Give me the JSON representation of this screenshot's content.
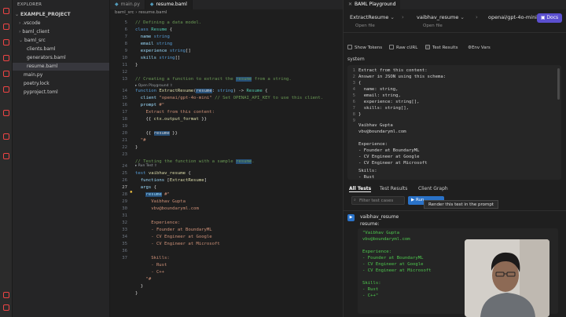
{
  "explorer": {
    "title": "EXPLORER",
    "items": [
      {
        "label": "EXAMPLE_PROJECT",
        "caret": "⌄"
      },
      {
        "label": ".vscode",
        "caret": "›"
      },
      {
        "label": "baml_client",
        "caret": "›"
      },
      {
        "label": "baml_src",
        "caret": "⌄"
      },
      {
        "label": "clients.baml",
        "caret": ""
      },
      {
        "label": "generators.baml",
        "caret": ""
      },
      {
        "label": "resume.baml",
        "caret": ""
      },
      {
        "label": "main.py",
        "caret": ""
      },
      {
        "label": "poetry.lock",
        "caret": ""
      },
      {
        "label": "pyproject.toml",
        "caret": ""
      }
    ]
  },
  "editor": {
    "tabs": [
      "main.py",
      "resume.baml"
    ],
    "breadcrumb": "baml_src  ›  resume.baml",
    "codelens_1": "▸ Open Playground ⇧",
    "codelens_2": "▸ Run Test ⇧",
    "line_numbers": [
      "5",
      "6",
      "7",
      "8",
      "9",
      "10",
      "11",
      "12",
      "13",
      "14",
      "15",
      "16",
      "17",
      "18",
      "19",
      "20",
      "21",
      "22",
      "23",
      "24",
      "25",
      "26",
      "27",
      "28",
      "29",
      "30",
      "31",
      "32",
      "33",
      "34",
      "35",
      "36",
      "37"
    ]
  },
  "playground": {
    "tab_title": "BAML Playground",
    "function_selector": "ExtractResume",
    "test_selector": "vaibhav_resume",
    "model_label": "openai/gpt-4o-mini",
    "open_file_label": "Open file",
    "docs_label": "Docs",
    "options": {
      "show_tokens": "Show Tokens",
      "raw_curl": "Raw cURL",
      "test_results": "Test Results",
      "env_vars": "Env Vars"
    },
    "system_label": "system",
    "prompt_lines": [
      "Extract from this content:",
      "Answer in JSON using this schema:",
      "{",
      "  name: string,",
      "  email: string,",
      "  experience: string[],",
      "  skills: string[],",
      "}",
      "",
      "Vaibhav Gupta",
      "vbv@boundaryml.com",
      "",
      "Experience:",
      "- Founder at BoundaryML",
      "- CV Engineer at Google",
      "- CV Engineer at Microsoft",
      "",
      "Skills:",
      "- Rust"
    ],
    "subtabs": [
      "All Tests",
      "Test Results",
      "Client Graph"
    ],
    "filter_placeholder": "Filter test cases",
    "run_button": "Run",
    "tooltip": "Render this test in the prompt",
    "test_name": "vaibhav_resume",
    "arg_name": "resume:",
    "resume_lines": [
      "\"Vaibhav Gupta",
      "vbv@boundaryml.com",
      "",
      "Experience:",
      "- Founder at BoundaryML",
      "- CV Engineer at Google",
      "- CV Engineer at Microsoft",
      "",
      "Skills:",
      "- Rust",
      "- C++\""
    ]
  },
  "colors": {
    "accent": "#2a72c8",
    "docs": "#5b4fcf",
    "resume_text": "#4ec94e"
  }
}
